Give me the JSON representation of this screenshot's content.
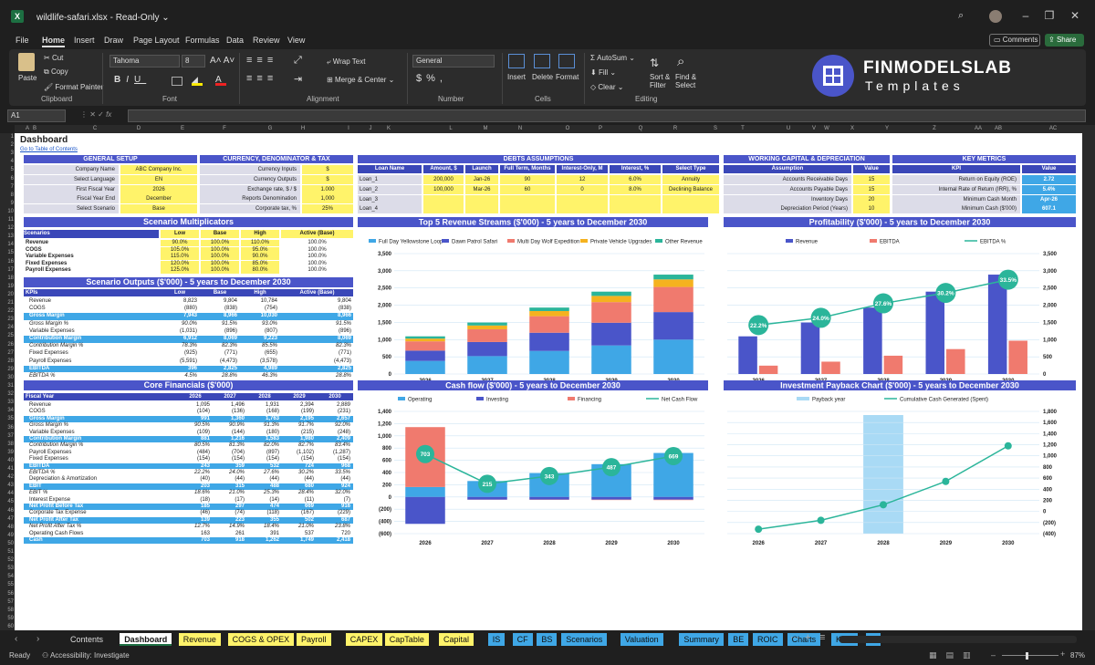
{
  "app": {
    "title": "wildlife-safari.xlsx",
    "mode": "Read-Only"
  },
  "menu": [
    "File",
    "Home",
    "Insert",
    "Draw",
    "Page Layout",
    "Formulas",
    "Data",
    "Review",
    "View"
  ],
  "titlebar": {
    "comments": "Comments",
    "share": "Share"
  },
  "ribbon": {
    "paste": "Paste",
    "cut": "Cut",
    "copy": "Copy",
    "format_painter": "Format Painter",
    "clipboard": "Clipboard",
    "font_name": "Tahoma",
    "font_size": "8",
    "font": "Font",
    "wrap": "Wrap Text",
    "merge": "Merge & Center",
    "alignment": "Alignment",
    "number_format": "General",
    "number": "Number",
    "insert": "Insert",
    "delete": "Delete",
    "format": "Format",
    "cells": "Cells",
    "autosum": "AutoSum",
    "fill": "Fill",
    "clear": "Clear",
    "sort": "Sort & Filter",
    "find": "Find & Select",
    "editing": "Editing",
    "brand1": "FINMODELSLAB",
    "brand2": "Templates"
  },
  "formula_bar": {
    "cell": "A1",
    "fx": "fx"
  },
  "columns": [
    "A",
    "B",
    "C",
    "D",
    "E",
    "F",
    "G",
    "H",
    "I",
    "J",
    "K",
    "L",
    "M",
    "N",
    "O",
    "P",
    "Q",
    "R",
    "S",
    "T",
    "U",
    "V",
    "W",
    "X",
    "Y",
    "Z",
    "AA",
    "AB",
    "AC",
    "AD"
  ],
  "sheet": {
    "title": "Dashboard",
    "toc": "Go to Table of Contents",
    "general": {
      "header": "GENERAL SETUP",
      "rows": [
        [
          "Company Name",
          "ABC Company Inc."
        ],
        [
          "Select Language",
          "EN"
        ],
        [
          "First Fiscal Year",
          "2026"
        ],
        [
          "Fiscal Year End",
          "December"
        ],
        [
          "Select Scenario",
          "Base"
        ]
      ]
    },
    "currency": {
      "header": "CURRENCY, DENOMINATOR & TAX",
      "rows": [
        [
          "Currency Inputs",
          "$"
        ],
        [
          "Currency Outputs",
          "$"
        ],
        [
          "Exchange rate, $ / $",
          "1.000"
        ],
        [
          "Reports Denomination",
          "1,000"
        ],
        [
          "Corporate tax, %",
          "25%"
        ]
      ]
    },
    "debts": {
      "header": "DEBTS ASSUMPTIONS",
      "cols": [
        "Loan Name",
        "Amount, $",
        "Launch",
        "Full Term, Months",
        "Interest-Only, M",
        "Interest, %",
        "Select Type"
      ],
      "rows": [
        [
          "Loan_1",
          "200,000",
          "Jan-26",
          "90",
          "12",
          "6.0%",
          "Annuity"
        ],
        [
          "Loan_2",
          "100,000",
          "Mar-26",
          "60",
          "0",
          "8.0%",
          "Declining Balance"
        ],
        [
          "Loan_3",
          "",
          "",
          "",
          "",
          "",
          ""
        ],
        [
          "Loan_4",
          "",
          "",
          "",
          "",
          "",
          ""
        ]
      ]
    },
    "wc": {
      "header": "WORKING CAPITAL & DEPRECIATION",
      "cols": [
        "Assumption",
        "Value"
      ],
      "rows": [
        [
          "Accounts Receivable Days",
          "15"
        ],
        [
          "Accounts Payable Days",
          "15"
        ],
        [
          "Inventory Days",
          "20"
        ],
        [
          "Depreciation Period (Years)",
          "10"
        ]
      ]
    },
    "kpi": {
      "header": "KEY METRICS",
      "cols": [
        "KPI",
        "Value"
      ],
      "rows": [
        [
          "Return on Equity (ROE)",
          "2.72"
        ],
        [
          "Internal Rate of Return (IRR), %",
          "5.4%"
        ],
        [
          "Minimum Cash Month",
          "Apr-26"
        ],
        [
          "Minimum Cash ($'000)",
          "607.1"
        ]
      ]
    },
    "multipliers": {
      "header": "Scenario Multiplicators",
      "cols": [
        "Scenarios",
        "Low",
        "Base",
        "High",
        "Active (Base)"
      ],
      "rows": [
        [
          "Revenue",
          "90.0%",
          "100.0%",
          "110.0%",
          "100.0%"
        ],
        [
          "COGS",
          "105.0%",
          "100.0%",
          "95.0%",
          "100.0%"
        ],
        [
          "Variable Expenses",
          "115.0%",
          "100.0%",
          "90.0%",
          "100.0%"
        ],
        [
          "Fixed Expenses",
          "120.0%",
          "100.0%",
          "85.0%",
          "100.0%"
        ],
        [
          "Payroll Expenses",
          "125.0%",
          "100.0%",
          "80.0%",
          "100.0%"
        ]
      ]
    },
    "outputs": {
      "header": "Scenario Outputs ($'000) - 5 years to December 2030",
      "cols": [
        "KPIs",
        "Low",
        "Base",
        "High",
        "Active (Base)"
      ],
      "rows": [
        [
          "Revenue",
          "8,823",
          "9,804",
          "10,784",
          "9,804",
          "n"
        ],
        [
          "COGS",
          "(880)",
          "(838)",
          "(754)",
          "(838)",
          "n"
        ],
        [
          "Gross Margin",
          "7,943",
          "8,966",
          "10,030",
          "8,966",
          "h"
        ],
        [
          "Gross Margin %",
          "90.0%",
          "91.5%",
          "93.0%",
          "91.5%",
          "i"
        ],
        [
          "Variable Expenses",
          "(1,031)",
          "(896)",
          "(807)",
          "(896)",
          "n"
        ],
        [
          "Contribution Margin",
          "6,912",
          "8,069",
          "9,223",
          "8,069",
          "h"
        ],
        [
          "Contribution Margin %",
          "78.3%",
          "82.3%",
          "85.5%",
          "82.3%",
          "i"
        ],
        [
          "Fixed Expenses",
          "(925)",
          "(771)",
          "(655)",
          "(771)",
          "n"
        ],
        [
          "Payroll Expenses",
          "(5,591)",
          "(4,473)",
          "(3,578)",
          "(4,473)",
          "n"
        ],
        [
          "EBITDA",
          "396",
          "2,825",
          "4,989",
          "2,825",
          "h"
        ],
        [
          "EBITDA %",
          "4.5%",
          "28.8%",
          "46.3%",
          "28.8%",
          "i"
        ]
      ]
    },
    "core": {
      "header": "Core Financials ($'000)",
      "cols": [
        "Fiscal Year",
        "2026",
        "2027",
        "2028",
        "2029",
        "2030"
      ],
      "rows": [
        [
          "Revenue",
          "1,095",
          "1,496",
          "1,931",
          "2,394",
          "2,889",
          "n"
        ],
        [
          "COGS",
          "(104)",
          "(136)",
          "(168)",
          "(199)",
          "(231)",
          "n"
        ],
        [
          "Gross Margin",
          "991",
          "1,360",
          "1,763",
          "2,195",
          "2,657",
          "h"
        ],
        [
          "Gross Margin %",
          "90.5%",
          "90.9%",
          "91.3%",
          "91.7%",
          "92.0%",
          "i"
        ],
        [
          "Variable Expenses",
          "(109)",
          "(144)",
          "(180)",
          "(215)",
          "(248)",
          "n"
        ],
        [
          "Contribution Margin",
          "881",
          "1,216",
          "1,583",
          "1,980",
          "2,409",
          "h"
        ],
        [
          "Contribution Margin %",
          "80.5%",
          "81.3%",
          "82.0%",
          "82.7%",
          "83.4%",
          "i"
        ],
        [
          "Payroll Expenses",
          "(484)",
          "(704)",
          "(897)",
          "(1,102)",
          "(1,287)",
          "n"
        ],
        [
          "Fixed Expenses",
          "(154)",
          "(154)",
          "(154)",
          "(154)",
          "(154)",
          "n"
        ],
        [
          "EBITDA",
          "243",
          "359",
          "532",
          "724",
          "968",
          "h"
        ],
        [
          "EBITDA %",
          "22.2%",
          "24.0%",
          "27.6%",
          "30.2%",
          "33.5%",
          "i"
        ],
        [
          "Depreciation & Amortization",
          "(40)",
          "(44)",
          "(44)",
          "(44)",
          "(44)",
          "n"
        ],
        [
          "EBIT",
          "203",
          "315",
          "488",
          "680",
          "924",
          "h"
        ],
        [
          "EBIT %",
          "18.6%",
          "21.0%",
          "25.3%",
          "28.4%",
          "32.0%",
          "i"
        ],
        [
          "Interest Expense",
          "(18)",
          "(17)",
          "(14)",
          "(11)",
          "(7)",
          "n"
        ],
        [
          "Net Profit Before Tax",
          "185",
          "297",
          "474",
          "669",
          "916",
          "h"
        ],
        [
          "Corporate Tax Expense",
          "(46)",
          "(74)",
          "(118)",
          "(167)",
          "(229)",
          "n"
        ],
        [
          "Net Profit After Tax",
          "139",
          "223",
          "355",
          "502",
          "687",
          "h"
        ],
        [
          "Net Profit After Tax %",
          "12.7%",
          "14.9%",
          "18.4%",
          "21.0%",
          "23.8%",
          "i"
        ],
        [
          "Operating Cash Flows",
          "163",
          "261",
          "391",
          "537",
          "720",
          "n"
        ],
        [
          "Cash",
          "703",
          "918",
          "1,262",
          "1,749",
          "2,418",
          "h"
        ]
      ]
    }
  },
  "charts": {
    "rev": {
      "title": "Top 5 Revenue Streams ($'000) - 5 years to December 2030",
      "legend": [
        "Full Day Yellowstone Loop",
        "Dawn Patrol Safari",
        "Multi Day Wolf Expedition",
        "Private Vehicle Upgrades",
        "Other Revenue"
      ]
    },
    "prof": {
      "title": "Profitability ($'000) - 5 years to December 2030",
      "legend": [
        "Revenue",
        "EBITDA",
        "EBITDA %"
      ]
    },
    "cash": {
      "title": "Cash flow ($'000) - 5 years to December 2030",
      "legend": [
        "Operating",
        "Investing",
        "Financing",
        "Net Cash Flow"
      ]
    },
    "pay": {
      "title": "Investment Payback Chart ($'000) - 5 years to December 2030",
      "legend": [
        "Payback year",
        "Cumulative Cash Generated (Spent)"
      ]
    }
  },
  "chart_data": [
    {
      "type": "bar",
      "title": "Top 5 Revenue Streams ($'000) - 5 years to December 2030",
      "categories": [
        "2026",
        "2027",
        "2028",
        "2029",
        "2030"
      ],
      "ylim": [
        0,
        3500
      ],
      "series": [
        {
          "name": "Full Day Yellowstone Loop",
          "values": [
            380,
            520,
            670,
            830,
            1000
          ],
          "color": "#3fa7e6"
        },
        {
          "name": "Dawn Patrol Safari",
          "values": [
            300,
            410,
            530,
            660,
            800
          ],
          "color": "#4a55c9"
        },
        {
          "name": "Multi Day Wolf Expedition",
          "values": [
            270,
            370,
            480,
            600,
            730
          ],
          "color": "#f07a6e"
        },
        {
          "name": "Private Vehicle Upgrades",
          "values": [
            80,
            110,
            150,
            180,
            220
          ],
          "color": "#f5b21f"
        },
        {
          "name": "Other Revenue",
          "values": [
            65,
            86,
            101,
            124,
            139
          ],
          "color": "#2bb59a"
        }
      ]
    },
    {
      "type": "bar",
      "title": "Profitability ($'000) - 5 years to December 2030",
      "categories": [
        "2026",
        "2027",
        "2028",
        "2029",
        "2030"
      ],
      "ylim": [
        0,
        3500
      ],
      "series": [
        {
          "name": "Revenue",
          "values": [
            1095,
            1496,
            1931,
            2394,
            2889
          ],
          "color": "#4a55c9"
        },
        {
          "name": "EBITDA",
          "values": [
            243,
            359,
            532,
            724,
            968
          ],
          "color": "#f07a6e"
        },
        {
          "name": "EBITDA %",
          "values": [
            22.2,
            24.0,
            27.6,
            30.2,
            33.5
          ],
          "color": "#2bb59a"
        }
      ]
    },
    {
      "type": "bar",
      "title": "Cash flow ($'000) - 5 years to December 2030",
      "categories": [
        "2026",
        "2027",
        "2028",
        "2029",
        "2030"
      ],
      "ylim": [
        -600,
        1400
      ],
      "series": [
        {
          "name": "Operating",
          "values": [
            163,
            261,
            391,
            537,
            720
          ],
          "color": "#3fa7e6"
        },
        {
          "name": "Investing",
          "values": [
            -440,
            -44,
            -44,
            -44,
            -44
          ],
          "color": "#4a55c9"
        },
        {
          "name": "Financing",
          "values": [
            980,
            -2,
            -4,
            -6,
            -7
          ],
          "color": "#f07a6e"
        },
        {
          "name": "Net Cash Flow",
          "values": [
            703,
            215,
            343,
            487,
            669
          ],
          "color": "#2bb59a"
        }
      ]
    },
    {
      "type": "line",
      "title": "Investment Payback Chart ($'000) - 5 years to December 2030",
      "categories": [
        "2026",
        "2027",
        "2028",
        "2029",
        "2030"
      ],
      "ylim": [
        -400,
        1800
      ],
      "payback_year": "2028",
      "series": [
        {
          "name": "Cumulative Cash Generated (Spent)",
          "values": [
            -320,
            -160,
            120,
            540,
            1180
          ],
          "color": "#2bb59a"
        }
      ]
    }
  ],
  "tabs": [
    {
      "n": "Contents",
      "c": ""
    },
    {
      "n": "Dashboard",
      "c": "active"
    },
    {
      "n": "Revenue",
      "c": "#fff36a"
    },
    {
      "n": "COGS & OPEX",
      "c": "#fff36a"
    },
    {
      "n": "Payroll",
      "c": "#fff36a"
    },
    {
      "n": "CAPEX",
      "c": "#fff36a"
    },
    {
      "n": "CapTable",
      "c": "#fff36a"
    },
    {
      "n": "Capital",
      "c": "#fff36a"
    },
    {
      "n": "IS",
      "c": "#3fa7e6"
    },
    {
      "n": "CF",
      "c": "#3fa7e6"
    },
    {
      "n": "BS",
      "c": "#3fa7e6"
    },
    {
      "n": "Scenarios",
      "c": "#3fa7e6"
    },
    {
      "n": "Valuation",
      "c": "#3fa7e6"
    },
    {
      "n": "Summary",
      "c": "#3fa7e6"
    },
    {
      "n": "BE",
      "c": "#3fa7e6"
    },
    {
      "n": "ROIC",
      "c": "#3fa7e6"
    },
    {
      "n": "Charts",
      "c": "#3fa7e6"
    },
    {
      "n": "KPIs",
      "c": "#3fa7e6"
    },
    {
      "n": "S",
      "c": "#3fa7e6"
    }
  ],
  "status": {
    "ready": "Ready",
    "accessibility": "Accessibility: Investigate",
    "zoom": "87%"
  }
}
